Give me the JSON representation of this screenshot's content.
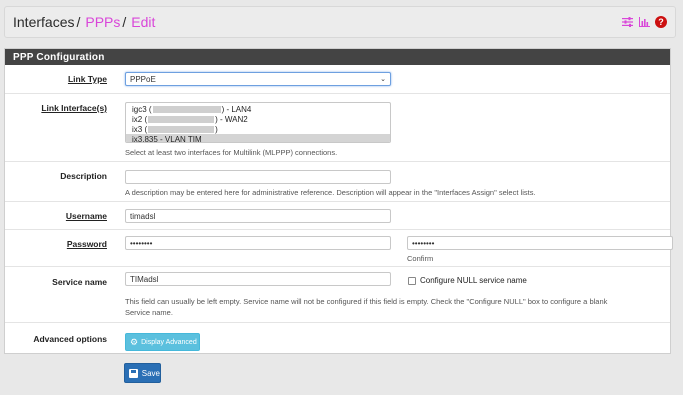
{
  "breadcrumb": {
    "root": "Interfaces",
    "items": [
      "PPPs",
      "Edit"
    ],
    "separator": "/"
  },
  "header_icons": [
    "sliders-icon",
    "bar-chart-icon",
    "help-icon"
  ],
  "panel": {
    "title": "PPP Configuration"
  },
  "link_type": {
    "label": "Link Type",
    "value": "PPPoE"
  },
  "link_interfaces": {
    "label": "Link Interface(s)",
    "options": [
      {
        "prefix": "igc3 (",
        "suffix": ") - LAN4",
        "redacted": true
      },
      {
        "prefix": "ix2 (",
        "suffix": ") - WAN2",
        "redacted": true
      },
      {
        "prefix": "ix3 (",
        "suffix": ")",
        "redacted": true
      },
      {
        "prefix": "ix3.835 - VLAN TIM",
        "suffix": "",
        "redacted": false,
        "selected": true
      }
    ],
    "help": "Select at least two interfaces for Multilink (MLPPP) connections."
  },
  "description": {
    "label": "Description",
    "value": "",
    "help": "A description may be entered here for administrative reference. Description will appear in the \"Interfaces Assign\" select lists."
  },
  "username": {
    "label": "Username",
    "value": "timadsl"
  },
  "password": {
    "label": "Password",
    "value": "••••••••",
    "confirm_value": "••••••••",
    "confirm_label": "Confirm"
  },
  "service_name": {
    "label": "Service name",
    "value": "TIMadsl",
    "null_checkbox_label": "Configure NULL service name",
    "null_checked": false,
    "help_line1": "This field can usually be left empty. Service name will not be configured if this field is empty. Check the \"Configure NULL\" box to configure a blank",
    "help_line2": "Service name."
  },
  "advanced": {
    "label": "Advanced options",
    "button_label": "Display Advanced"
  },
  "save": {
    "label": "Save"
  },
  "colors": {
    "breadcrumb_link": "#d946d9",
    "panel_heading_bg": "#444444",
    "info_button": "#5bc0de",
    "primary_button": "#2a6fb5",
    "help_icon": "#cc1010"
  }
}
